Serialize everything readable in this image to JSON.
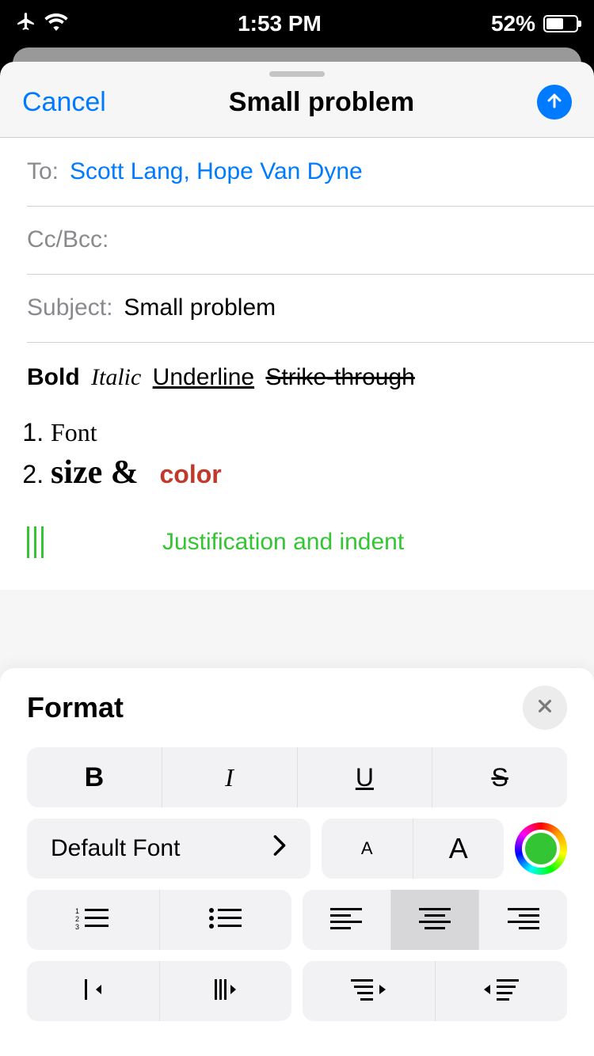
{
  "status": {
    "time": "1:53 PM",
    "battery": "52%"
  },
  "compose": {
    "cancel": "Cancel",
    "title": "Small problem",
    "fields": {
      "to_label": "To:",
      "to_value": "Scott Lang, Hope Van Dyne",
      "cc_label": "Cc/Bcc:",
      "subject_label": "Subject:",
      "subject_value": "Small problem"
    },
    "body": {
      "bold": "Bold",
      "italic": "Italic",
      "underline": "Underline",
      "strike": "Strike-through",
      "li1": "Font",
      "li2_a": "size  &",
      "li2_b": "color",
      "justification": "Justification and indent"
    }
  },
  "format_panel": {
    "title": "Format",
    "font_button": "Default Font",
    "styles": {
      "bold": "B",
      "italic": "I",
      "underline": "U",
      "strike": "S"
    },
    "size_small": "A",
    "size_large": "A"
  }
}
